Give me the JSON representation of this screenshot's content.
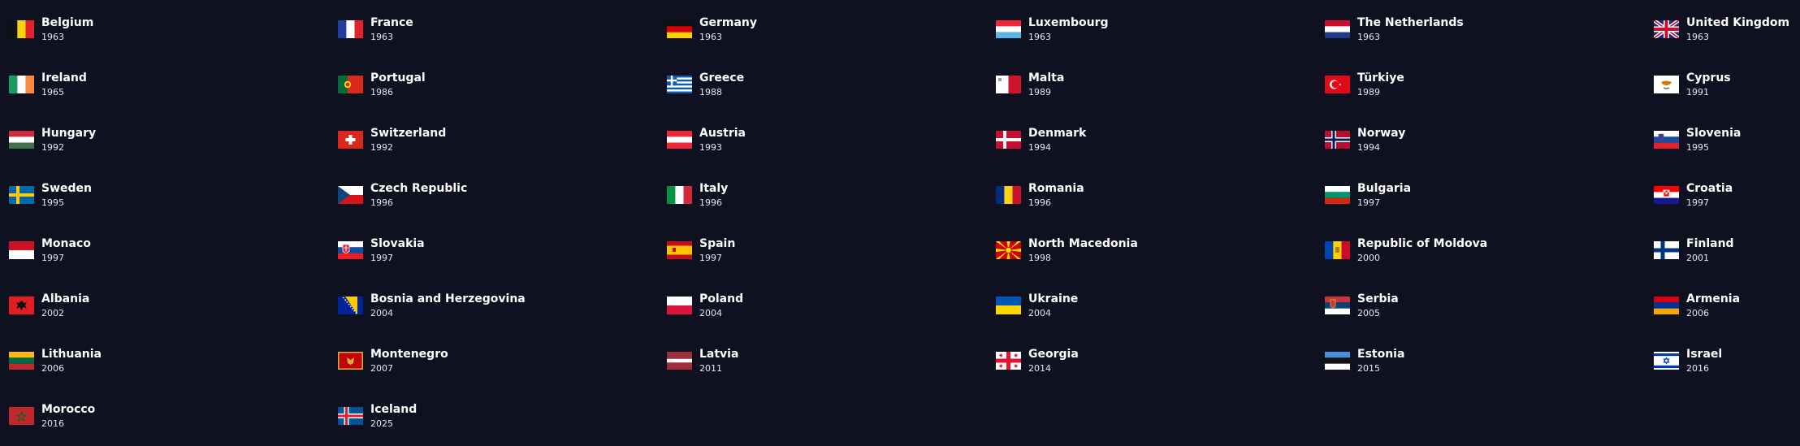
{
  "countries": [
    {
      "name": "Belgium",
      "year": "1963",
      "flag": "belgium-flag-icon"
    },
    {
      "name": "France",
      "year": "1963",
      "flag": "france-flag-icon"
    },
    {
      "name": "Germany",
      "year": "1963",
      "flag": "germany-flag-icon"
    },
    {
      "name": "Luxembourg",
      "year": "1963",
      "flag": "luxembourg-flag-icon"
    },
    {
      "name": "The Netherlands",
      "year": "1963",
      "flag": "netherlands-flag-icon"
    },
    {
      "name": "United Kingdom",
      "year": "1963",
      "flag": "united-kingdom-flag-icon"
    },
    {
      "name": "Ireland",
      "year": "1965",
      "flag": "ireland-flag-icon"
    },
    {
      "name": "Portugal",
      "year": "1986",
      "flag": "portugal-flag-icon"
    },
    {
      "name": "Greece",
      "year": "1988",
      "flag": "greece-flag-icon"
    },
    {
      "name": "Malta",
      "year": "1989",
      "flag": "malta-flag-icon"
    },
    {
      "name": "Türkiye",
      "year": "1989",
      "flag": "turkiye-flag-icon"
    },
    {
      "name": "Cyprus",
      "year": "1991",
      "flag": "cyprus-flag-icon"
    },
    {
      "name": "Hungary",
      "year": "1992",
      "flag": "hungary-flag-icon"
    },
    {
      "name": "Switzerland",
      "year": "1992",
      "flag": "switzerland-flag-icon"
    },
    {
      "name": "Austria",
      "year": "1993",
      "flag": "austria-flag-icon"
    },
    {
      "name": "Denmark",
      "year": "1994",
      "flag": "denmark-flag-icon"
    },
    {
      "name": "Norway",
      "year": "1994",
      "flag": "norway-flag-icon"
    },
    {
      "name": "Slovenia",
      "year": "1995",
      "flag": "slovenia-flag-icon"
    },
    {
      "name": "Sweden",
      "year": "1995",
      "flag": "sweden-flag-icon"
    },
    {
      "name": "Czech Republic",
      "year": "1996",
      "flag": "czech-republic-flag-icon"
    },
    {
      "name": "Italy",
      "year": "1996",
      "flag": "italy-flag-icon"
    },
    {
      "name": "Romania",
      "year": "1996",
      "flag": "romania-flag-icon"
    },
    {
      "name": "Bulgaria",
      "year": "1997",
      "flag": "bulgaria-flag-icon"
    },
    {
      "name": "Croatia",
      "year": "1997",
      "flag": "croatia-flag-icon"
    },
    {
      "name": "Monaco",
      "year": "1997",
      "flag": "monaco-flag-icon"
    },
    {
      "name": "Slovakia",
      "year": "1997",
      "flag": "slovakia-flag-icon"
    },
    {
      "name": "Spain",
      "year": "1997",
      "flag": "spain-flag-icon"
    },
    {
      "name": "North Macedonia",
      "year": "1998",
      "flag": "north-macedonia-flag-icon"
    },
    {
      "name": "Republic of Moldova",
      "year": "2000",
      "flag": "moldova-flag-icon"
    },
    {
      "name": "Finland",
      "year": "2001",
      "flag": "finland-flag-icon"
    },
    {
      "name": "Albania",
      "year": "2002",
      "flag": "albania-flag-icon"
    },
    {
      "name": "Bosnia and Herzegovina",
      "year": "2004",
      "flag": "bosnia-herzegovina-flag-icon"
    },
    {
      "name": "Poland",
      "year": "2004",
      "flag": "poland-flag-icon"
    },
    {
      "name": "Ukraine",
      "year": "2004",
      "flag": "ukraine-flag-icon"
    },
    {
      "name": "Serbia",
      "year": "2005",
      "flag": "serbia-flag-icon"
    },
    {
      "name": "Armenia",
      "year": "2006",
      "flag": "armenia-flag-icon"
    },
    {
      "name": "Lithuania",
      "year": "2006",
      "flag": "lithuania-flag-icon"
    },
    {
      "name": "Montenegro",
      "year": "2007",
      "flag": "montenegro-flag-icon"
    },
    {
      "name": "Latvia",
      "year": "2011",
      "flag": "latvia-flag-icon"
    },
    {
      "name": "Georgia",
      "year": "2014",
      "flag": "georgia-flag-icon"
    },
    {
      "name": "Estonia",
      "year": "2015",
      "flag": "estonia-flag-icon"
    },
    {
      "name": "Israel",
      "year": "2016",
      "flag": "israel-flag-icon"
    },
    {
      "name": "Morocco",
      "year": "2016",
      "flag": "morocco-flag-icon"
    },
    {
      "name": "Iceland",
      "year": "2025",
      "flag": "iceland-flag-icon"
    }
  ],
  "colors": {
    "background": "#0f1120",
    "name_text": "#ffffff",
    "year_text": "#e5e7ef"
  }
}
